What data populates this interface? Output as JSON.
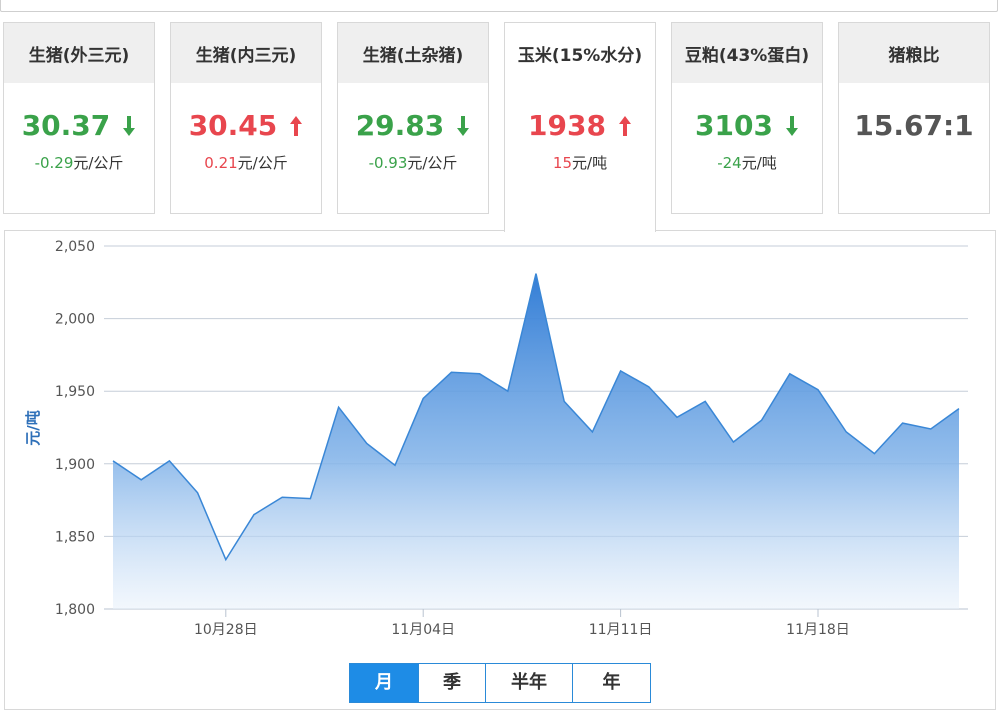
{
  "cards": [
    {
      "name": "生猪(外三元)",
      "price": "30.37",
      "change": "-0.29",
      "unit": "元/公斤",
      "direction": "down"
    },
    {
      "name": "生猪(内三元)",
      "price": "30.45",
      "change": "0.21",
      "unit": "元/公斤",
      "direction": "up"
    },
    {
      "name": "生猪(土杂猪)",
      "price": "29.83",
      "change": "-0.93",
      "unit": "元/公斤",
      "direction": "down"
    },
    {
      "name": "玉米(15%水分)",
      "price": "1938",
      "change": "15",
      "unit": "元/吨",
      "direction": "up"
    },
    {
      "name": "豆粕(43%蛋白)",
      "price": "3103",
      "change": "-24",
      "unit": "元/吨",
      "direction": "down"
    },
    {
      "name": "猪粮比",
      "price": "15.67:1"
    }
  ],
  "active_card": 3,
  "colors": {
    "up": "#e8464e",
    "down": "#3aa24a",
    "neutral": "#555555",
    "accent": "#1e8ce6",
    "series": "#3a87d6"
  },
  "icons": {
    "up": "arrow-up-icon",
    "down": "arrow-down-icon"
  },
  "period_tabs": [
    "月",
    "季",
    "半年",
    "年"
  ],
  "active_period": "月",
  "chart_data": {
    "type": "area",
    "ylabel": "元/吨",
    "ylim": [
      1800,
      2050
    ],
    "yticks": [
      "1,800",
      "1,850",
      "1,900",
      "1,950",
      "2,000",
      "2,050"
    ],
    "xticks": [
      "10月28日",
      "11月04日",
      "11月11日",
      "11月18日"
    ],
    "grid": true,
    "series": [
      {
        "values": [
          1902,
          1889,
          1902,
          1880,
          1834,
          1865,
          1877,
          1876,
          1939,
          1914,
          1899,
          1945,
          1963,
          1962,
          1950,
          2031,
          1943,
          1922,
          1964,
          1953,
          1932,
          1943,
          1915,
          1930,
          1962,
          1951,
          1922,
          1907,
          1928,
          1924,
          1938
        ]
      }
    ]
  }
}
